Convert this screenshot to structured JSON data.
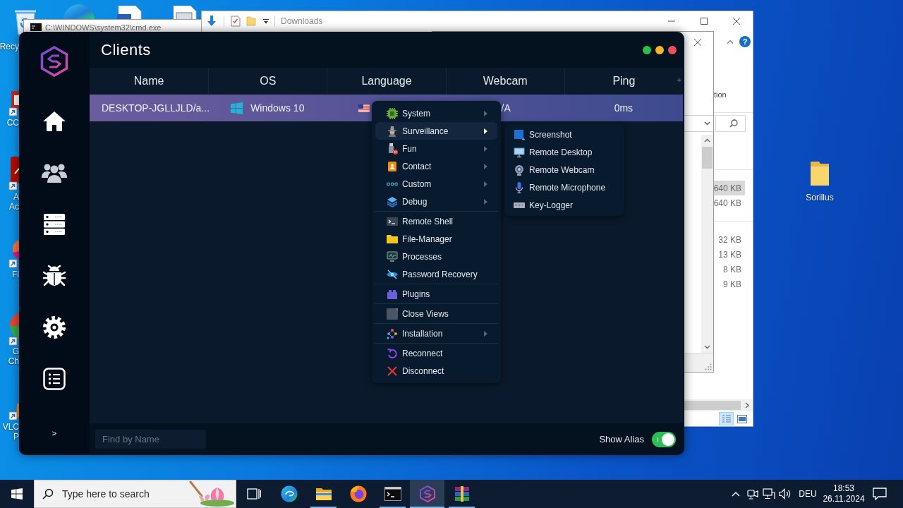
{
  "desktop": {
    "left_icons": [
      {
        "lines": [
          "Recy"
        ]
      },
      {
        "lines": [
          "CC"
        ]
      },
      {
        "lines": [
          "A",
          "Ac"
        ]
      },
      {
        "lines": [
          "Fi"
        ]
      },
      {
        "lines": [
          "G",
          "Ch"
        ]
      },
      {
        "lines": [
          "VLC",
          "P"
        ]
      }
    ],
    "right_icons": [
      {
        "label": "Sorillus"
      }
    ]
  },
  "cmd_window": {
    "title": "C:\\WINDOWS\\system32\\cmd.exe"
  },
  "explorer_window": {
    "title": "Downloads",
    "help": "?",
    "ribbon_text": "tion",
    "size_groups": [
      [
        {
          "size": "640 KB",
          "selected": true
        },
        {
          "size": "640 KB",
          "selected": false
        }
      ],
      [
        {
          "size": "32 KB",
          "selected": false
        },
        {
          "size": "13 KB",
          "selected": false
        },
        {
          "size": "8 KB",
          "selected": false
        },
        {
          "size": "9 KB",
          "selected": false
        }
      ]
    ],
    "view_buttons": [
      {
        "selected": true
      },
      {
        "selected": false
      }
    ]
  },
  "app": {
    "title": "Clients",
    "sidebar": {
      "expand": ">"
    },
    "table": {
      "columns": [
        "Name",
        "OS",
        "Language",
        "Webcam",
        "Ping"
      ],
      "add_column": "+",
      "rows": [
        {
          "name": "DESKTOP-JGLLJLD/a...",
          "os": "Windows 10",
          "webcam": "/A",
          "ping": "0ms",
          "selected": true
        }
      ]
    },
    "search": {
      "placeholder": "Find by Name"
    },
    "show_alias": {
      "label": "Show Alias",
      "on": true
    }
  },
  "context_menu": {
    "groups": [
      [
        {
          "label": "System",
          "submenu": true,
          "selected": false
        },
        {
          "label": "Surveillance",
          "submenu": true,
          "selected": true
        },
        {
          "label": "Fun",
          "submenu": true,
          "selected": false
        },
        {
          "label": "Contact",
          "submenu": true,
          "selected": false
        },
        {
          "label": "Custom",
          "submenu": true,
          "selected": false
        },
        {
          "label": "Debug",
          "submenu": true,
          "selected": false
        }
      ],
      [
        {
          "label": "Remote Shell",
          "submenu": false,
          "selected": false
        },
        {
          "label": "File-Manager",
          "submenu": false,
          "selected": false
        },
        {
          "label": "Processes",
          "submenu": false,
          "selected": false
        },
        {
          "label": "Password Recovery",
          "submenu": false,
          "selected": false
        }
      ],
      [
        {
          "label": "Plugins",
          "submenu": false,
          "selected": false
        }
      ],
      [
        {
          "label": "Close Views",
          "submenu": false,
          "selected": false
        }
      ],
      [
        {
          "label": "Installation",
          "submenu": true,
          "selected": false
        }
      ],
      [
        {
          "label": "Reconnect",
          "submenu": false,
          "selected": false
        },
        {
          "label": "Disconnect",
          "submenu": false,
          "selected": false
        }
      ]
    ]
  },
  "submenu": {
    "items": [
      {
        "label": "Screenshot"
      },
      {
        "label": "Remote Desktop"
      },
      {
        "label": "Remote Webcam"
      },
      {
        "label": "Remote Microphone"
      },
      {
        "label": "Key-Logger"
      }
    ]
  },
  "taskbar": {
    "search": {
      "placeholder": "Type here to search"
    },
    "apps": [
      {
        "running": false,
        "selected": false
      },
      {
        "running": true,
        "selected": false
      },
      {
        "running": false,
        "selected": false
      },
      {
        "running": true,
        "selected": false
      },
      {
        "running": true,
        "selected": true
      },
      {
        "running": true,
        "selected": false
      }
    ],
    "language": "DEU",
    "time": "18:53",
    "date": "26.11.2024"
  }
}
